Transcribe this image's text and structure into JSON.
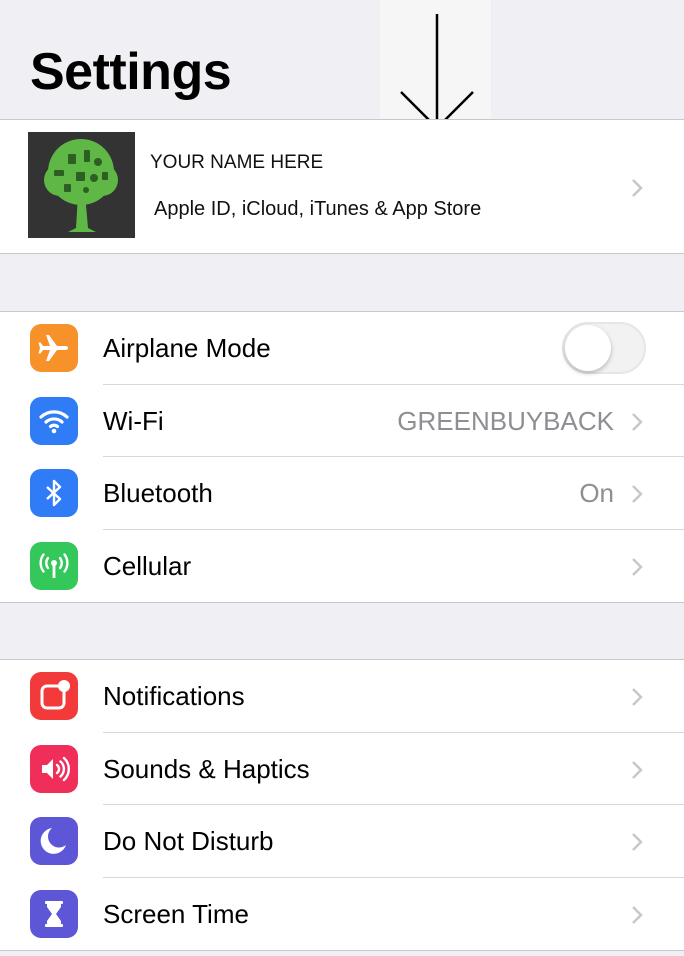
{
  "header": {
    "title": "Settings"
  },
  "profile": {
    "name": "YOUR NAME HERE",
    "subtitle": "Apple ID, iCloud, iTunes & App Store"
  },
  "connectivity": [
    {
      "label": "Airplane Mode",
      "icon": "airplane-icon",
      "color": "#f7922a",
      "toggle": "off"
    },
    {
      "label": "Wi-Fi",
      "icon": "wifi-icon",
      "color": "#2f7cf6",
      "value": "GREENBUYBACK"
    },
    {
      "label": "Bluetooth",
      "icon": "bluetooth-icon",
      "color": "#2f7cf6",
      "value": "On"
    },
    {
      "label": "Cellular",
      "icon": "cellular-icon",
      "color": "#34c759"
    }
  ],
  "general": [
    {
      "label": "Notifications",
      "icon": "notifications-icon",
      "color": "#f23a3a"
    },
    {
      "label": "Sounds & Haptics",
      "icon": "speaker-icon",
      "color": "#f02e5a"
    },
    {
      "label": "Do Not Disturb",
      "icon": "moon-icon",
      "color": "#5d56d6"
    },
    {
      "label": "Screen Time",
      "icon": "hourglass-icon",
      "color": "#5d56d6"
    }
  ]
}
